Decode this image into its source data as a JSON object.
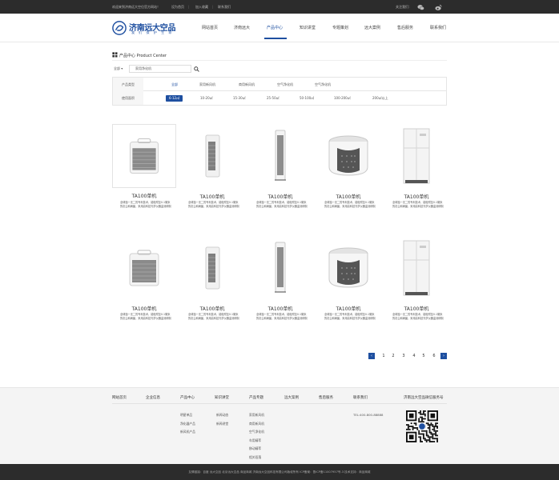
{
  "topbar": {
    "welcome": "欢迎来到济南远大空位官方网站！",
    "links": [
      "设为首页",
      "加入收藏",
      "联系我们"
    ],
    "follow": "关注我们：",
    "icons": [
      "wechat-icon",
      "weibo-icon"
    ]
  },
  "brand": {
    "name": "济南远大空品",
    "slogan": "我 们 保 护 生 命",
    "color": "#1e4fa0"
  },
  "nav": {
    "items": [
      "网站首页",
      "济南远大",
      "产品中心",
      "知识讲堂",
      "专题策划",
      "远大案例",
      "售后服务",
      "联系我们"
    ],
    "active": "产品中心"
  },
  "breadcrumb": "产品中心 Product Center",
  "search": {
    "category": "全部",
    "value": "家用净化机"
  },
  "filters": {
    "type_label": "产品类型",
    "types": [
      "全部",
      "家用新风机",
      "商用新风机",
      "空气净化机",
      "空气净化机"
    ],
    "type_active": "全部",
    "area_label": "使用面积",
    "areas": [
      "6-12㎡",
      "10-20㎡",
      "15-30㎡",
      "25-50㎡",
      "50-100㎡",
      "100-200㎡",
      "200㎡以上"
    ],
    "area_active": "6-12㎡"
  },
  "products": [
    {
      "name": "TA100单机",
      "desc": "全球独一无二的专利技术，能吸附至0.1微米的灰尘和病菌，采用高科技光学仪器监测研制",
      "shape": "cube",
      "selected": true
    },
    {
      "name": "TA100单机",
      "desc": "全球独一无二的专利技术，能吸附至0.1微米的灰尘和病菌，采用高科技光学仪器监测研制",
      "shape": "slim"
    },
    {
      "name": "TA100单机",
      "desc": "全球独一无二的专利技术，能吸附至0.1微米的灰尘和病菌，采用高科技光学仪器监测研制",
      "shape": "tower"
    },
    {
      "name": "TA100单机",
      "desc": "全球独一无二的专利技术，能吸附至0.1微米的灰尘和病菌，采用高科技光学仪器监测研制",
      "shape": "round"
    },
    {
      "name": "TA100单机",
      "desc": "全球独一无二的专利技术，能吸附至0.1微米的灰尘和病菌，采用高科技光学仪器监测研制",
      "shape": "cabinet"
    },
    {
      "name": "TA100单机",
      "desc": "全球独一无二的专利技术，能吸附至0.1微米的灰尘和病菌，采用高科技光学仪器监测研制",
      "shape": "cube"
    },
    {
      "name": "TA100单机",
      "desc": "全球独一无二的专利技术，能吸附至0.1微米的灰尘和病菌，采用高科技光学仪器监测研制",
      "shape": "slim"
    },
    {
      "name": "TA100单机",
      "desc": "全球独一无二的专利技术，能吸附至0.1微米的灰尘和病菌，采用高科技光学仪器监测研制",
      "shape": "tower"
    },
    {
      "name": "TA100单机",
      "desc": "全球独一无二的专利技术，能吸附至0.1微米的灰尘和病菌，采用高科技光学仪器监测研制",
      "shape": "round"
    },
    {
      "name": "TA100单机",
      "desc": "全球独一无二的专利技术，能吸附至0.1微米的灰尘和病菌，采用高科技光学仪器监测研制",
      "shape": "cabinet"
    }
  ],
  "pagination": {
    "prev": "‹",
    "pages": [
      "1",
      "2",
      "3",
      "4",
      "5",
      "6"
    ],
    "current": "1",
    "next": "›"
  },
  "footer": {
    "columns": [
      {
        "title": "网站首页",
        "links": []
      },
      {
        "title": "企业信息",
        "links": []
      },
      {
        "title": "产品中心",
        "links": [
          "明星单品",
          "净化器产品",
          "新风机产品"
        ]
      },
      {
        "title": "知识讲堂",
        "links": [
          "新闻动态",
          "新闻讲堂"
        ]
      },
      {
        "title": "产品专题",
        "links": [
          "家用新风机",
          "商用新风机",
          "空气净化机",
          "车用精萃",
          "移动精萃",
          "相关段落"
        ]
      },
      {
        "title": "远大案例",
        "links": []
      },
      {
        "title": "售后服务",
        "links": []
      },
      {
        "title": "联系我们",
        "links": [
          "TEL:400-800-88888"
        ]
      }
    ],
    "qr_title": "济南远大空品微信服务号",
    "copyright": "友情链接：百度 远大空品 北京远大空品 商品商城    济南远大空品科技有限公司版权所有    ICP备案：鲁ICP备11007957号-3    技术支持：商品商城"
  }
}
